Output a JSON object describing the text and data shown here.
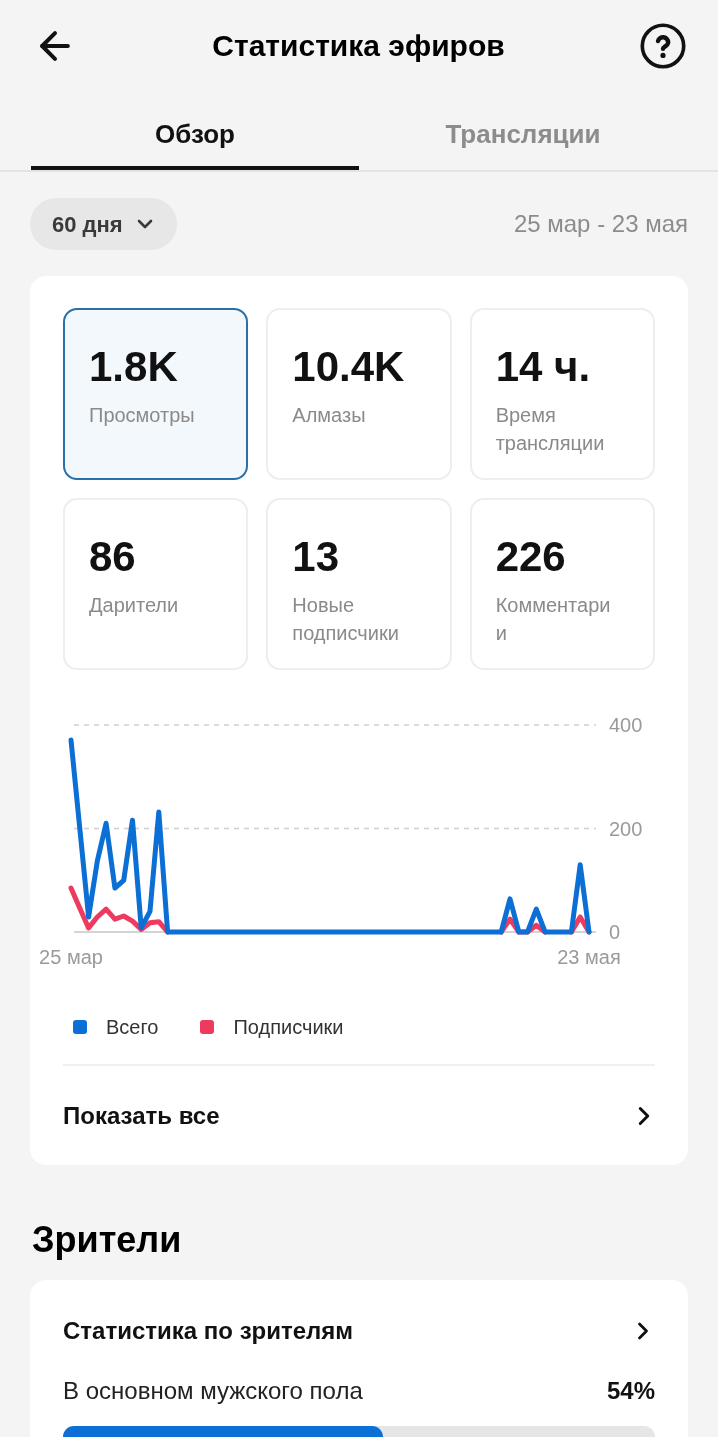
{
  "header": {
    "title": "Статистика эфиров"
  },
  "tabs": [
    {
      "label": "Обзор",
      "selected": true
    },
    {
      "label": "Трансляции",
      "selected": false
    }
  ],
  "filter": {
    "period": "60 дня",
    "date_range": "25 мар - 23 мая"
  },
  "overview": {
    "metrics": [
      {
        "value": "1.8K",
        "label": "Просмотры",
        "selected": true
      },
      {
        "value": "10.4K",
        "label": "Алмазы",
        "selected": false
      },
      {
        "value": "14 ч.",
        "label": "Время трансляции",
        "selected": false
      },
      {
        "value": "86",
        "label": "Дарители",
        "selected": false
      },
      {
        "value": "13",
        "label": "Новые подписчики",
        "selected": false
      },
      {
        "value": "226",
        "label": "Комментарии",
        "selected": false
      }
    ],
    "chart_data": {
      "type": "line",
      "ylim": [
        0,
        400
      ],
      "yticks": [
        0,
        200,
        400
      ],
      "legend": "bottom",
      "categories": [
        "25 мар",
        null,
        null,
        null,
        null,
        null,
        null,
        null,
        null,
        null,
        null,
        null,
        null,
        null,
        null,
        null,
        null,
        null,
        null,
        null,
        null,
        null,
        null,
        null,
        null,
        null,
        null,
        null,
        null,
        null,
        null,
        null,
        null,
        null,
        null,
        null,
        null,
        null,
        null,
        null,
        null,
        null,
        null,
        null,
        null,
        null,
        null,
        null,
        null,
        null,
        null,
        null,
        null,
        null,
        null,
        null,
        null,
        null,
        null,
        "23 мая"
      ],
      "series": [
        {
          "name": "Всего",
          "color": "#0b6fd6",
          "values": [
            371,
            200,
            29,
            137,
            210,
            85,
            100,
            216,
            8,
            40,
            232,
            0,
            0,
            0,
            0,
            0,
            0,
            0,
            0,
            0,
            0,
            0,
            0,
            0,
            0,
            0,
            0,
            0,
            0,
            0,
            0,
            0,
            0,
            0,
            0,
            0,
            0,
            0,
            0,
            0,
            0,
            0,
            0,
            0,
            0,
            0,
            0,
            0,
            0,
            0,
            64,
            0,
            0,
            44,
            0,
            0,
            0,
            0,
            130,
            0
          ]
        },
        {
          "name": "Подписчики",
          "color": "#ee3a5f",
          "values": [
            85,
            46,
            8,
            29,
            44,
            25,
            31,
            21,
            5,
            18,
            20,
            0,
            null,
            null,
            null,
            null,
            null,
            null,
            null,
            null,
            null,
            null,
            null,
            null,
            null,
            null,
            null,
            null,
            null,
            null,
            null,
            null,
            null,
            null,
            null,
            null,
            null,
            null,
            null,
            null,
            null,
            null,
            null,
            null,
            null,
            null,
            null,
            null,
            null,
            0,
            25,
            0,
            0,
            13,
            0,
            null,
            null,
            0,
            29,
            0
          ]
        }
      ]
    },
    "show_all": "Показать все"
  },
  "viewers": {
    "title": "Зрители",
    "card_title": "Статистика по зрителям",
    "gender": {
      "label": "В основном мужского пола",
      "reading": "54%",
      "level": 0.54
    }
  }
}
